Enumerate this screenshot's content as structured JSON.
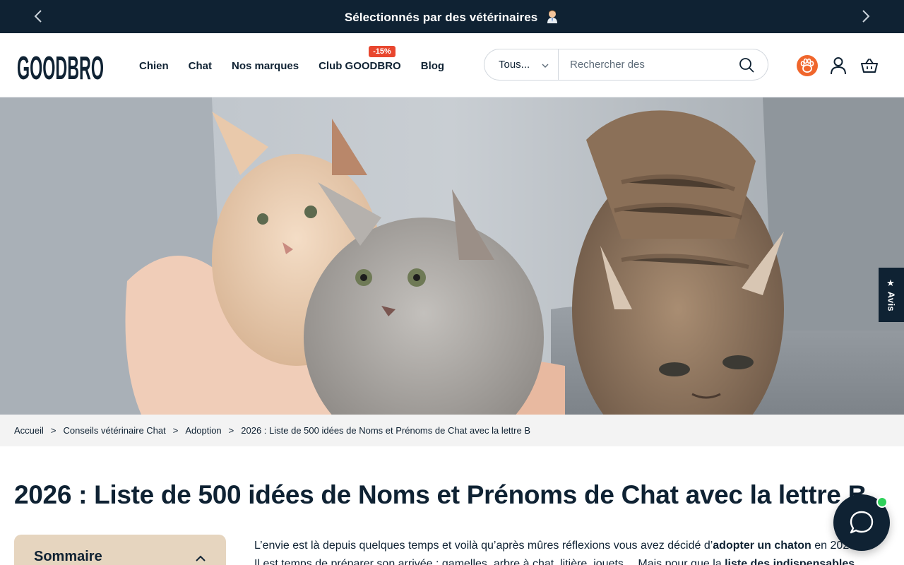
{
  "announcement": {
    "message": "Sélectionnés par des vétérinaires",
    "prev_icon": "chevron-left-icon",
    "next_icon": "chevron-right-icon"
  },
  "header": {
    "logo_text": "GOODBRO",
    "nav": [
      {
        "label": "Chien"
      },
      {
        "label": "Chat"
      },
      {
        "label": "Nos marques"
      },
      {
        "label": "Club GOODBRO",
        "badge": "-15%"
      },
      {
        "label": "Blog"
      }
    ],
    "search": {
      "category_value": "Tous...",
      "placeholder": "Rechercher des"
    },
    "icons": [
      "paw-icon",
      "user-icon",
      "basket-icon"
    ]
  },
  "avis_tab": {
    "label": "★ Avis"
  },
  "breadcrumb": [
    "Accueil",
    "Conseils vétérinaire Chat",
    "Adoption",
    "2026 : Liste de 500 idées de Noms et Prénoms de Chat avec la lettre B"
  ],
  "article": {
    "title": "2026 : Liste de 500 idées de Noms et Prénoms de Chat avec la lettre B",
    "sommaire_label": "Sommaire",
    "intro_line1_a": "L’envie est là depuis quelques temps et voilà qu’après mûres réflexions vous avez décidé d’",
    "intro_line1_b": "adopter un chaton",
    "intro_line1_c": " en 2026.",
    "intro_line2_a": "Il est temps de préparer son arrivée : gamelles, arbre à chat, litière, jouets… Mais pour que la ",
    "intro_line2_b": "liste des indispensables"
  },
  "colors": {
    "navy": "#0f2233",
    "badge": "#e8472f",
    "sommaire_bg": "#e6d5bf",
    "paw_orange": "#f0662c",
    "online_dot": "#2fd15a"
  }
}
